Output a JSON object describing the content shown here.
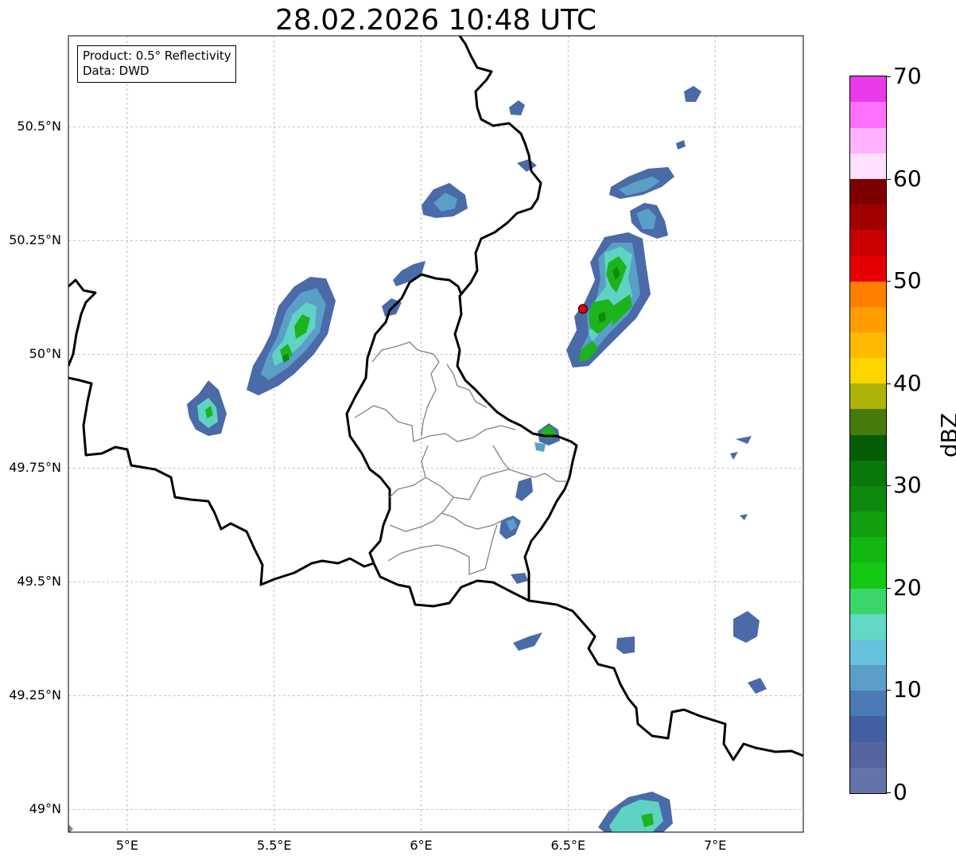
{
  "title": "28.02.2026 10:48 UTC",
  "info": {
    "product": "Product: 0.5° Reflectivity",
    "source": "Data: DWD"
  },
  "map": {
    "lon_range": [
      4.8,
      7.3
    ],
    "lat_range": [
      48.95,
      50.7
    ],
    "lat_ticks": [
      {
        "value": 50.5,
        "label": "50.5°N"
      },
      {
        "value": 50.25,
        "label": "50.25°N"
      },
      {
        "value": 50.0,
        "label": "50°N"
      },
      {
        "value": 49.75,
        "label": "49.75°N"
      },
      {
        "value": 49.5,
        "label": "49.5°N"
      },
      {
        "value": 49.25,
        "label": "49.25°N"
      },
      {
        "value": 49.0,
        "label": "49°N"
      }
    ],
    "lon_ticks": [
      {
        "value": 5.0,
        "label": "5°E"
      },
      {
        "value": 5.5,
        "label": "5.5°E"
      },
      {
        "value": 6.0,
        "label": "6°E"
      },
      {
        "value": 6.5,
        "label": "6.5°E"
      },
      {
        "value": 7.0,
        "label": "7°E"
      }
    ],
    "grid": true,
    "radar_site": {
      "lon": 6.55,
      "lat": 50.1,
      "color": "#e8000b"
    },
    "border_color": "#000000",
    "district_color": "#808080",
    "echo_colors": {
      "weak": "#4a6aa8",
      "light": "#5b9ec7",
      "cyan": "#5fd3c3",
      "green": "#1db31d",
      "dark_green": "#0f8a0f"
    }
  },
  "colorbar": {
    "label": "dBZ",
    "min": 0,
    "max": 70,
    "ticks": [
      "0",
      "10",
      "20",
      "30",
      "40",
      "50",
      "60",
      "70"
    ],
    "colors": [
      "#6574a8",
      "#55669e",
      "#4360a4",
      "#4b79b3",
      "#5b9ec7",
      "#66c1dc",
      "#63d8c4",
      "#3cd56c",
      "#14c814",
      "#11b611",
      "#0f9f0f",
      "#0d8a0d",
      "#0a770a",
      "#055e05",
      "#477a0a",
      "#adb309",
      "#ffd500",
      "#ffba00",
      "#ff9d00",
      "#ff7e00",
      "#e60000",
      "#c80000",
      "#a00000",
      "#7d0000",
      "#ffe0ff",
      "#ffb3ff",
      "#ff70ff",
      "#e83ae8"
    ]
  }
}
